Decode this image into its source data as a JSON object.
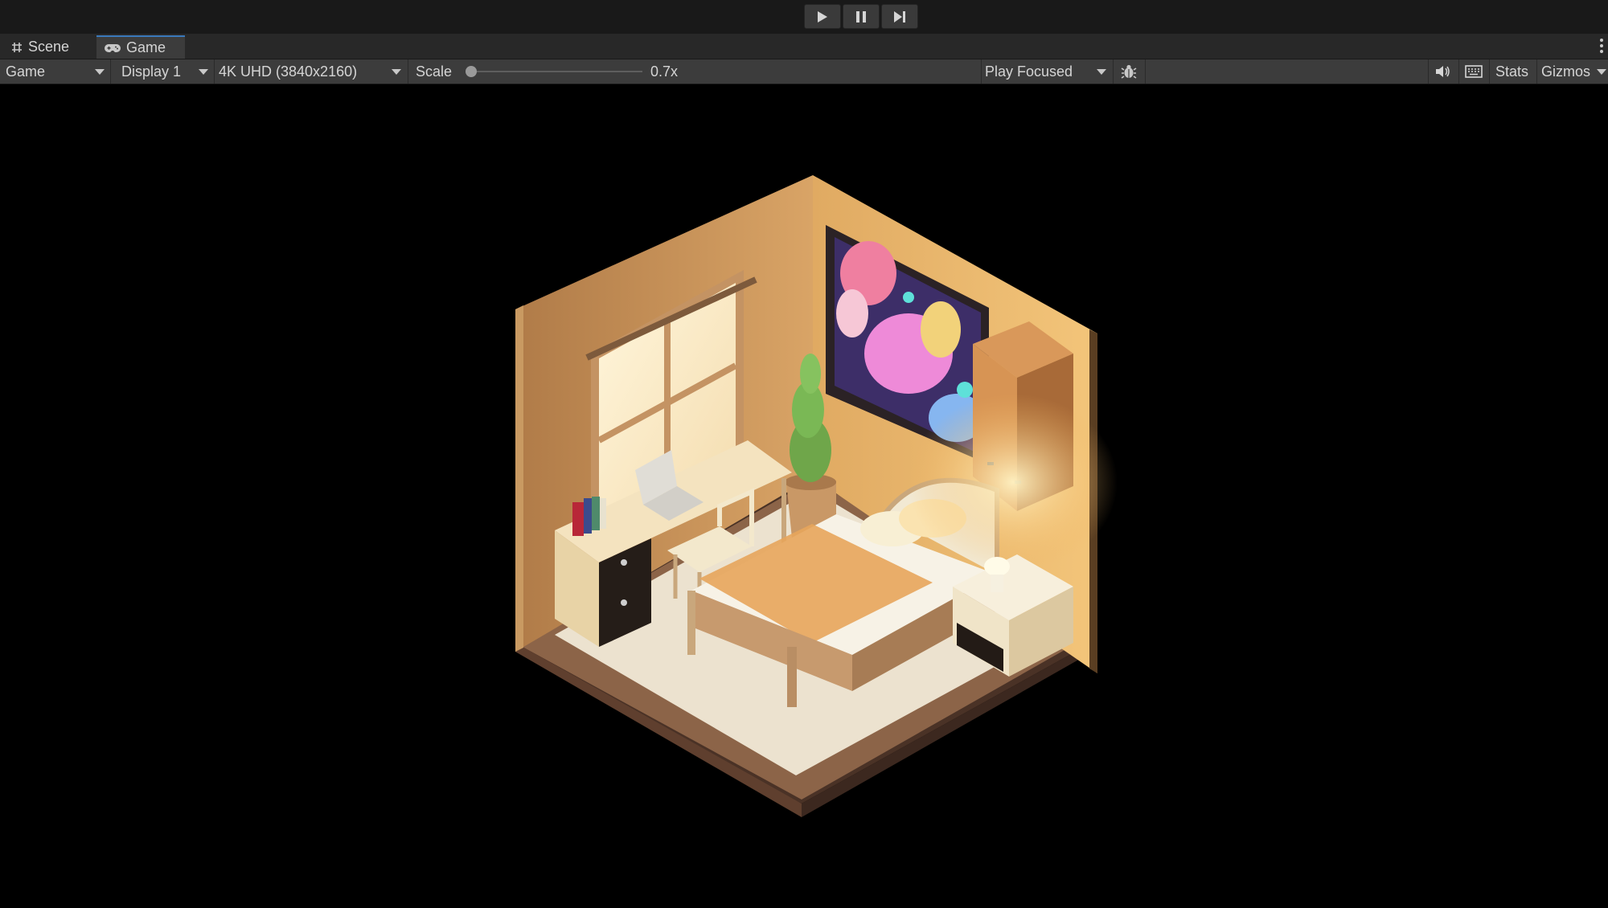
{
  "toolbar": {
    "play_icon": "play-icon",
    "pause_icon": "pause-icon",
    "step_icon": "step-icon"
  },
  "tabs": [
    {
      "label": "Scene",
      "icon": "grid-hash-icon"
    },
    {
      "label": "Game",
      "icon": "gamepad-icon"
    }
  ],
  "controls": {
    "view_mode": "Game",
    "display": "Display 1",
    "resolution": "4K UHD (3840x2160)",
    "scale_label": "Scale",
    "scale_value": "0.7x",
    "play_mode": "Play Focused",
    "debug_icon": "bug-icon",
    "audio_icon": "speaker-icon",
    "keyboard_icon": "keyboard-icon",
    "stats_label": "Stats",
    "gizmos_label": "Gizmos"
  },
  "colors": {
    "accent_tab": "#3a79bb",
    "panel_bg": "#3c3c3c",
    "toolbar_bg": "#191919",
    "view_bg": "#000000"
  },
  "scene": {
    "description_icon": "isometric-bedroom-scene"
  }
}
